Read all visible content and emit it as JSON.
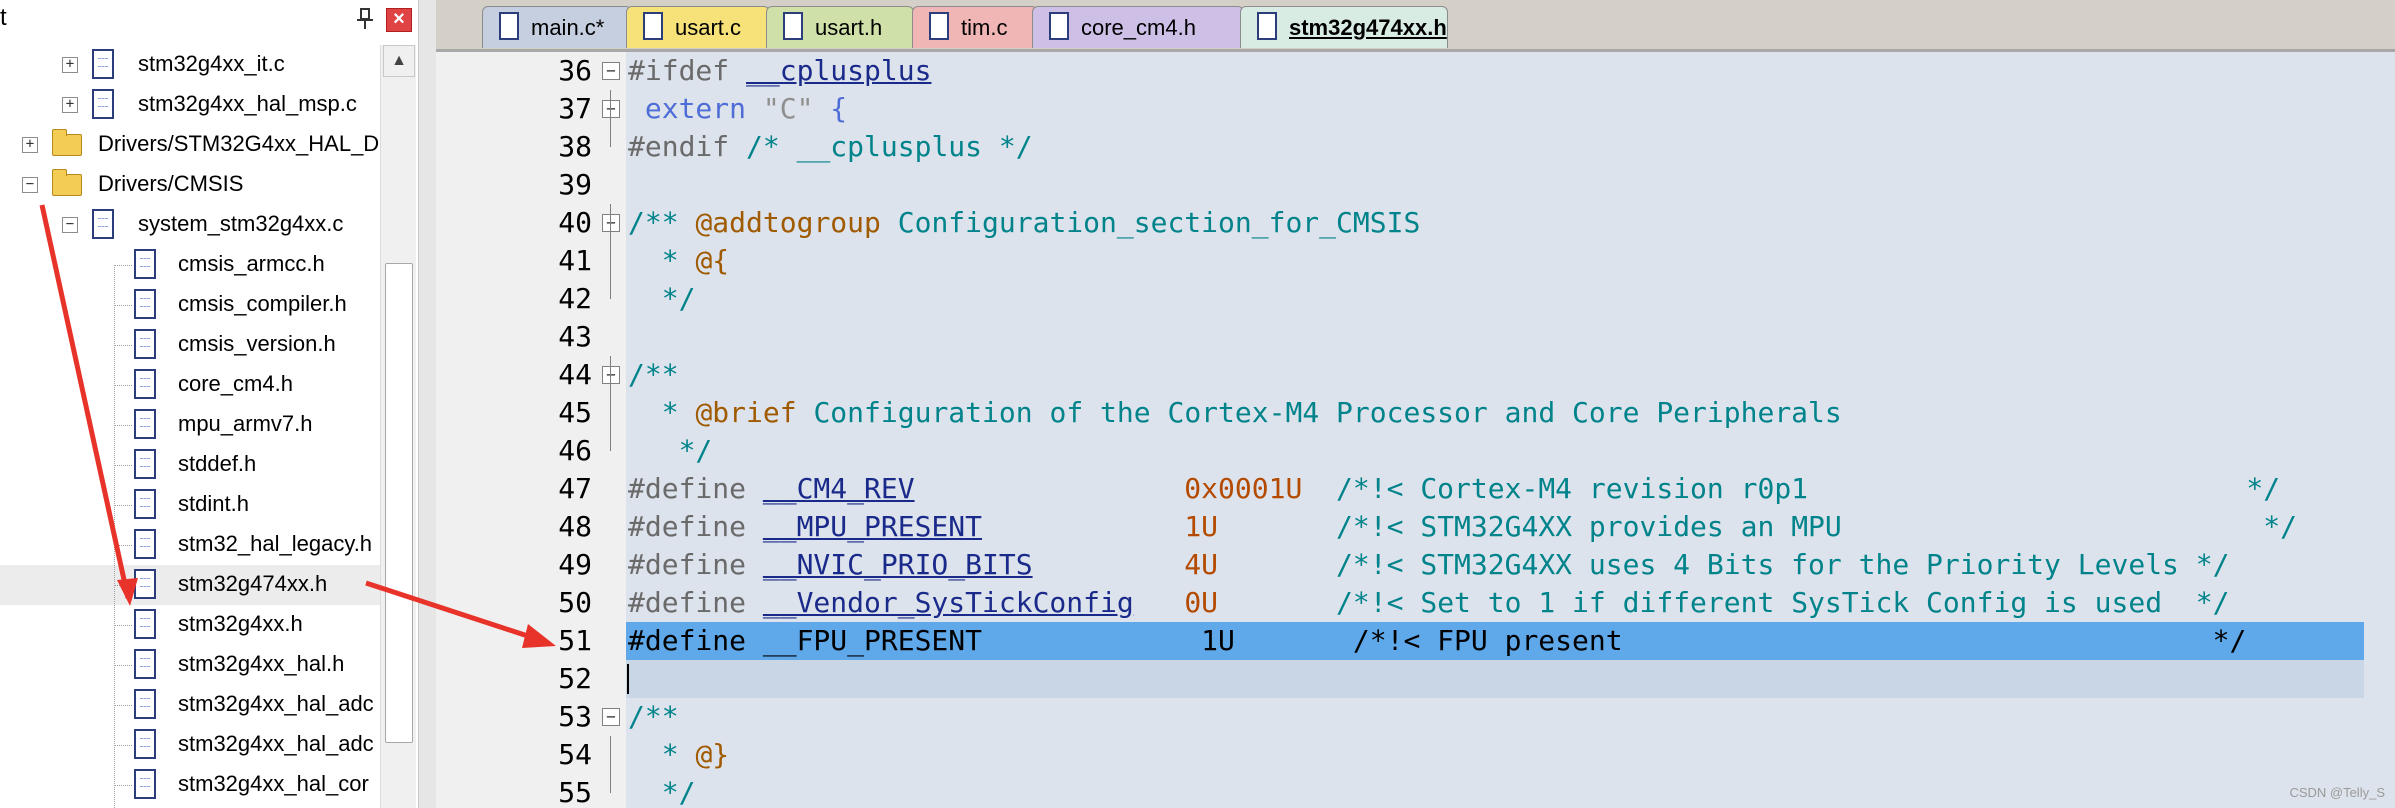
{
  "panel": {
    "title_fragment": "t",
    "close_glyph": "×"
  },
  "tree": [
    {
      "label": "stm32g4xx_it.c",
      "type": "file",
      "expander": "+"
    },
    {
      "label": "stm32g4xx_hal_msp.c",
      "type": "file",
      "expander": "+"
    },
    {
      "label": "Drivers/STM32G4xx_HAL_D",
      "type": "folder",
      "expander": "+"
    },
    {
      "label": "Drivers/CMSIS",
      "type": "folder",
      "expander": "−"
    },
    {
      "label": "system_stm32g4xx.c",
      "type": "file",
      "expander": "−"
    },
    {
      "label": "cmsis_armcc.h",
      "type": "file"
    },
    {
      "label": "cmsis_compiler.h",
      "type": "file"
    },
    {
      "label": "cmsis_version.h",
      "type": "file"
    },
    {
      "label": "core_cm4.h",
      "type": "file"
    },
    {
      "label": "mpu_armv7.h",
      "type": "file"
    },
    {
      "label": "stddef.h",
      "type": "file"
    },
    {
      "label": "stdint.h",
      "type": "file"
    },
    {
      "label": "stm32_hal_legacy.h",
      "type": "file"
    },
    {
      "label": "stm32g474xx.h",
      "type": "file",
      "selected": true
    },
    {
      "label": "stm32g4xx.h",
      "type": "file"
    },
    {
      "label": "stm32g4xx_hal.h",
      "type": "file"
    },
    {
      "label": "stm32g4xx_hal_adc",
      "type": "file"
    },
    {
      "label": "stm32g4xx_hal_adc",
      "type": "file"
    },
    {
      "label": "stm32g4xx_hal_cor",
      "type": "file"
    }
  ],
  "tabs": [
    {
      "label": "main.c*",
      "color": "#c6cfe0"
    },
    {
      "label": "usart.c",
      "color": "#f7e27a"
    },
    {
      "label": "usart.h",
      "color": "#cfe0a8"
    },
    {
      "label": "tim.c",
      "color": "#f0b5b5"
    },
    {
      "label": "core_cm4.h",
      "color": "#cdbfe6"
    },
    {
      "label": "stm32g474xx.h",
      "color": "#d8ece4",
      "active": true
    }
  ],
  "code_lines": [
    {
      "n": "36",
      "fold": "−",
      "parts": [
        [
          "kw",
          "#ifdef "
        ],
        [
          "mac",
          "__cplusplus"
        ]
      ]
    },
    {
      "n": "37",
      "fold": "−",
      "parts": [
        [
          "kw2",
          " extern "
        ],
        [
          "str",
          "\"C\""
        ],
        [
          "kw2",
          " {"
        ]
      ]
    },
    {
      "n": "38",
      "parts": [
        [
          "kw",
          "#endif "
        ],
        [
          "cm",
          "/* __cplusplus */"
        ]
      ]
    },
    {
      "n": "39",
      "parts": []
    },
    {
      "n": "40",
      "fold": "−",
      "parts": [
        [
          "cm",
          "/** "
        ],
        [
          "tag",
          "@addtogroup"
        ],
        [
          "cm",
          " Configuration_section_for_CMSIS"
        ]
      ]
    },
    {
      "n": "41",
      "parts": [
        [
          "cm",
          "  * "
        ],
        [
          "tag",
          "@{"
        ]
      ]
    },
    {
      "n": "42",
      "parts": [
        [
          "cm",
          "  */"
        ]
      ]
    },
    {
      "n": "43",
      "parts": []
    },
    {
      "n": "44",
      "fold": "−",
      "parts": [
        [
          "cm",
          "/**"
        ]
      ]
    },
    {
      "n": "45",
      "parts": [
        [
          "cm",
          "  * "
        ],
        [
          "tag",
          "@brief"
        ],
        [
          "cm",
          " Configuration of the Cortex-M4 Processor and Core Peripherals"
        ]
      ]
    },
    {
      "n": "46",
      "parts": [
        [
          "cm",
          "   */"
        ]
      ]
    },
    {
      "n": "47",
      "parts": [
        [
          "kw",
          "#define "
        ],
        [
          "mac",
          "__CM4_REV"
        ],
        [
          "plain",
          "                "
        ],
        [
          "num",
          "0x0001U"
        ],
        [
          "plain",
          "  "
        ],
        [
          "cm",
          "/*!< Cortex-M4 revision r0p1                          */"
        ]
      ]
    },
    {
      "n": "48",
      "parts": [
        [
          "kw",
          "#define "
        ],
        [
          "mac",
          "__MPU_PRESENT"
        ],
        [
          "plain",
          "            "
        ],
        [
          "num",
          "1U"
        ],
        [
          "plain",
          "       "
        ],
        [
          "cm",
          "/*!< STM32G4XX provides an MPU                         */"
        ]
      ]
    },
    {
      "n": "49",
      "parts": [
        [
          "kw",
          "#define "
        ],
        [
          "mac",
          "__NVIC_PRIO_BITS"
        ],
        [
          "plain",
          "         "
        ],
        [
          "num",
          "4U"
        ],
        [
          "plain",
          "       "
        ],
        [
          "cm",
          "/*!< STM32G4XX uses 4 Bits for the Priority Levels */"
        ]
      ]
    },
    {
      "n": "50",
      "parts": [
        [
          "kw",
          "#define "
        ],
        [
          "mac",
          "__Vendor_SysTickConfig"
        ],
        [
          "plain",
          "   "
        ],
        [
          "num",
          "0U"
        ],
        [
          "plain",
          "       "
        ],
        [
          "cm",
          "/*!< Set to 1 if different SysTick Config is used  */"
        ]
      ]
    },
    {
      "n": "51",
      "hl": true,
      "parts": [
        [
          "plain",
          "#define __FPU_PRESENT             1U       /*!< FPU present                                   */"
        ]
      ]
    },
    {
      "n": "52",
      "caret": true,
      "parts": []
    },
    {
      "n": "53",
      "fold": "−",
      "parts": [
        [
          "cm",
          "/**"
        ]
      ]
    },
    {
      "n": "54",
      "parts": [
        [
          "cm",
          "  * "
        ],
        [
          "tag",
          "@}"
        ]
      ]
    },
    {
      "n": "55",
      "parts": [
        [
          "cm",
          "  */"
        ]
      ]
    }
  ],
  "watermark": "CSDN @Telly_S",
  "annotation_color": "#e8332a"
}
